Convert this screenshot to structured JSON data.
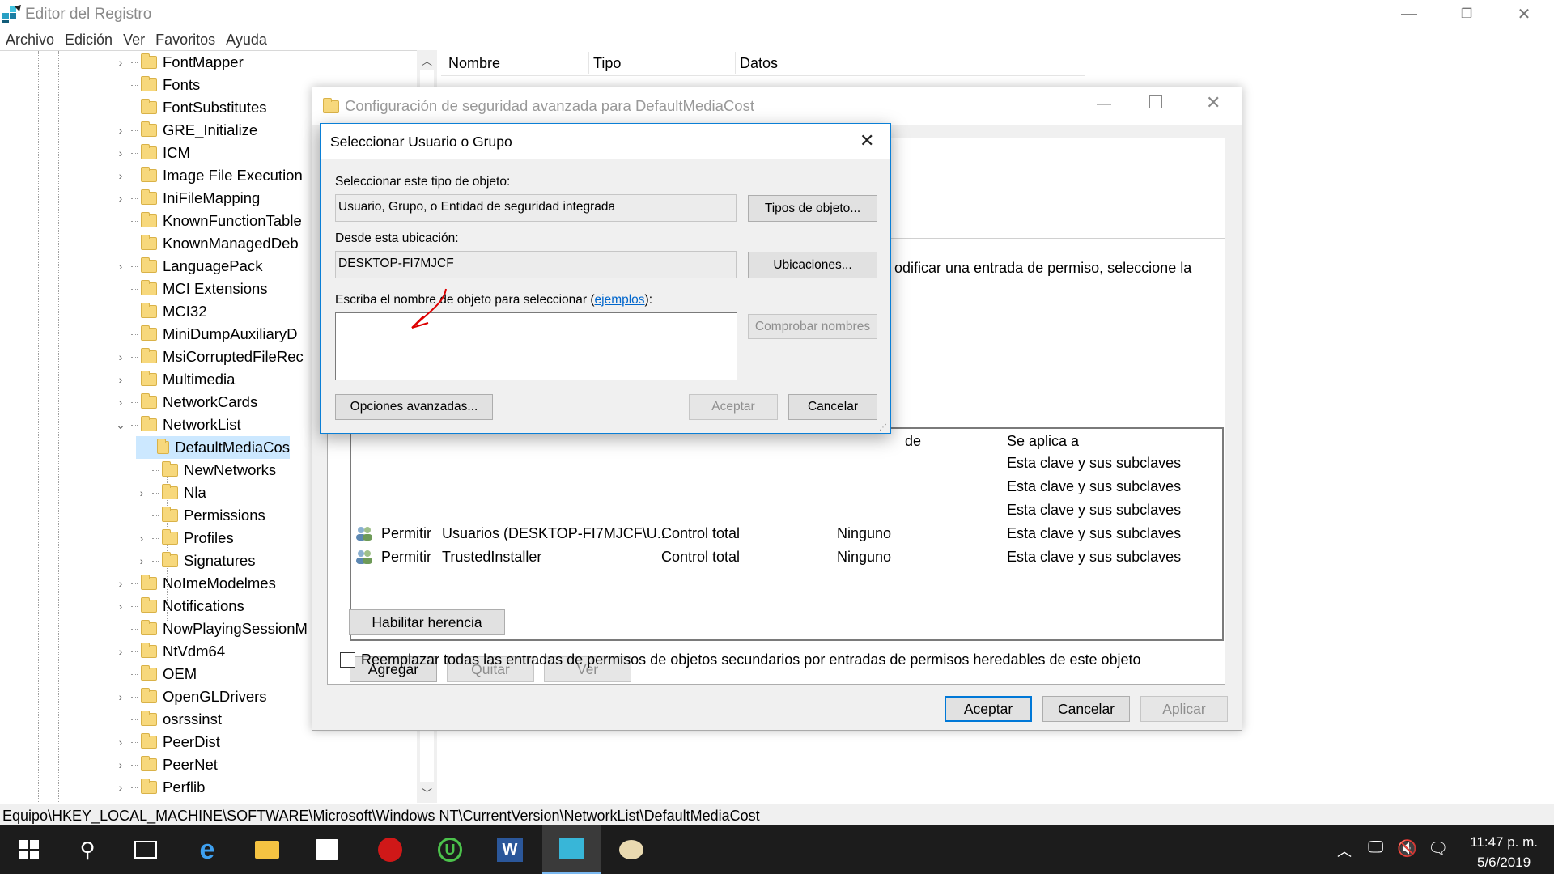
{
  "window": {
    "title": "Editor del Registro"
  },
  "menu": [
    "Archivo",
    "Edición",
    "Ver",
    "Favoritos",
    "Ayuda"
  ],
  "tree": [
    {
      "label": "FontMapper",
      "level": 0,
      "expander": true
    },
    {
      "label": "Fonts",
      "level": 0,
      "expander": false
    },
    {
      "label": "FontSubstitutes",
      "level": 0,
      "expander": false
    },
    {
      "label": "GRE_Initialize",
      "level": 0,
      "expander": true
    },
    {
      "label": "ICM",
      "level": 0,
      "expander": true
    },
    {
      "label": "Image File Execution",
      "level": 0,
      "expander": true
    },
    {
      "label": "IniFileMapping",
      "level": 0,
      "expander": true
    },
    {
      "label": "KnownFunctionTable",
      "level": 0,
      "expander": false
    },
    {
      "label": "KnownManagedDeb",
      "level": 0,
      "expander": false
    },
    {
      "label": "LanguagePack",
      "level": 0,
      "expander": true
    },
    {
      "label": "MCI Extensions",
      "level": 0,
      "expander": false
    },
    {
      "label": "MCI32",
      "level": 0,
      "expander": false
    },
    {
      "label": "MiniDumpAuxiliaryD",
      "level": 0,
      "expander": false
    },
    {
      "label": "MsiCorruptedFileRec",
      "level": 0,
      "expander": true
    },
    {
      "label": "Multimedia",
      "level": 0,
      "expander": true
    },
    {
      "label": "NetworkCards",
      "level": 0,
      "expander": true
    },
    {
      "label": "NetworkList",
      "level": 0,
      "expander": "open"
    },
    {
      "label": "DefaultMediaCos",
      "level": 1,
      "expander": false,
      "selected": true
    },
    {
      "label": "NewNetworks",
      "level": 1,
      "expander": false
    },
    {
      "label": "Nla",
      "level": 1,
      "expander": true
    },
    {
      "label": "Permissions",
      "level": 1,
      "expander": false
    },
    {
      "label": "Profiles",
      "level": 1,
      "expander": true
    },
    {
      "label": "Signatures",
      "level": 1,
      "expander": true
    },
    {
      "label": "NoImeModelmes",
      "level": 0,
      "expander": true
    },
    {
      "label": "Notifications",
      "level": 0,
      "expander": true
    },
    {
      "label": "NowPlayingSessionM",
      "level": 0,
      "expander": false
    },
    {
      "label": "NtVdm64",
      "level": 0,
      "expander": true
    },
    {
      "label": "OEM",
      "level": 0,
      "expander": false
    },
    {
      "label": "OpenGLDrivers",
      "level": 0,
      "expander": true
    },
    {
      "label": "osrssinst",
      "level": 0,
      "expander": false
    },
    {
      "label": "PeerDist",
      "level": 0,
      "expander": true
    },
    {
      "label": "PeerNet",
      "level": 0,
      "expander": true
    },
    {
      "label": "Perflib",
      "level": 0,
      "expander": true
    }
  ],
  "list": {
    "col_name": "Nombre",
    "col_type": "Tipo",
    "col_data": "Datos"
  },
  "status_path": "Equipo\\HKEY_LOCAL_MACHINE\\SOFTWARE\\Microsoft\\Windows NT\\CurrentVersion\\NetworkList\\DefaultMediaCost",
  "adv": {
    "title": "Configuración de seguridad avanzada para DefaultMediaCost",
    "note": "odificar una entrada de permiso, seleccione la",
    "col_partial": "de",
    "col_applies": "Se aplica a",
    "applies_rows": [
      "Esta clave y sus subclaves",
      "Esta clave y sus subclaves",
      "Esta clave y sus subclaves"
    ],
    "entries": [
      {
        "type": "Permitir",
        "principal": "Usuarios (DESKTOP-FI7MJCF\\U...",
        "access": "Control total",
        "inherited": "Ninguno",
        "applies": "Esta clave y sus subclaves"
      },
      {
        "type": "Permitir",
        "principal": "TrustedInstaller",
        "access": "Control total",
        "inherited": "Ninguno",
        "applies": "Esta clave y sus subclaves"
      }
    ],
    "btn_add": "Agregar",
    "btn_remove": "Quitar",
    "btn_view": "Ver",
    "btn_inherit": "Habilitar herencia",
    "replace_label": "Reemplazar todas las entradas de permisos de objetos secundarios por entradas de permisos heredables de este objeto",
    "btn_ok": "Aceptar",
    "btn_cancel": "Cancelar",
    "btn_apply": "Aplicar"
  },
  "sel": {
    "title": "Seleccionar Usuario o Grupo",
    "type_label": "Seleccionar este tipo de objeto:",
    "type_value": "Usuario, Grupo, o Entidad de seguridad integrada",
    "btn_types": "Tipos de objeto...",
    "loc_label": "Desde esta ubicación:",
    "loc_value": "DESKTOP-FI7MJCF",
    "btn_loc": "Ubicaciones...",
    "name_label_pre": "Escriba el nombre de objeto para seleccionar (",
    "name_link": "ejemplos",
    "name_label_post": "):",
    "name_value": "",
    "btn_check": "Comprobar nombres",
    "btn_advanced": "Opciones avanzadas...",
    "btn_ok": "Aceptar",
    "btn_cancel": "Cancelar"
  },
  "clock": {
    "time": "11:47 p. m.",
    "date": "5/6/2019"
  },
  "colors": {
    "accent": "#0078d7",
    "selection": "#cce8ff",
    "taskbar": "#1c1c1c"
  }
}
